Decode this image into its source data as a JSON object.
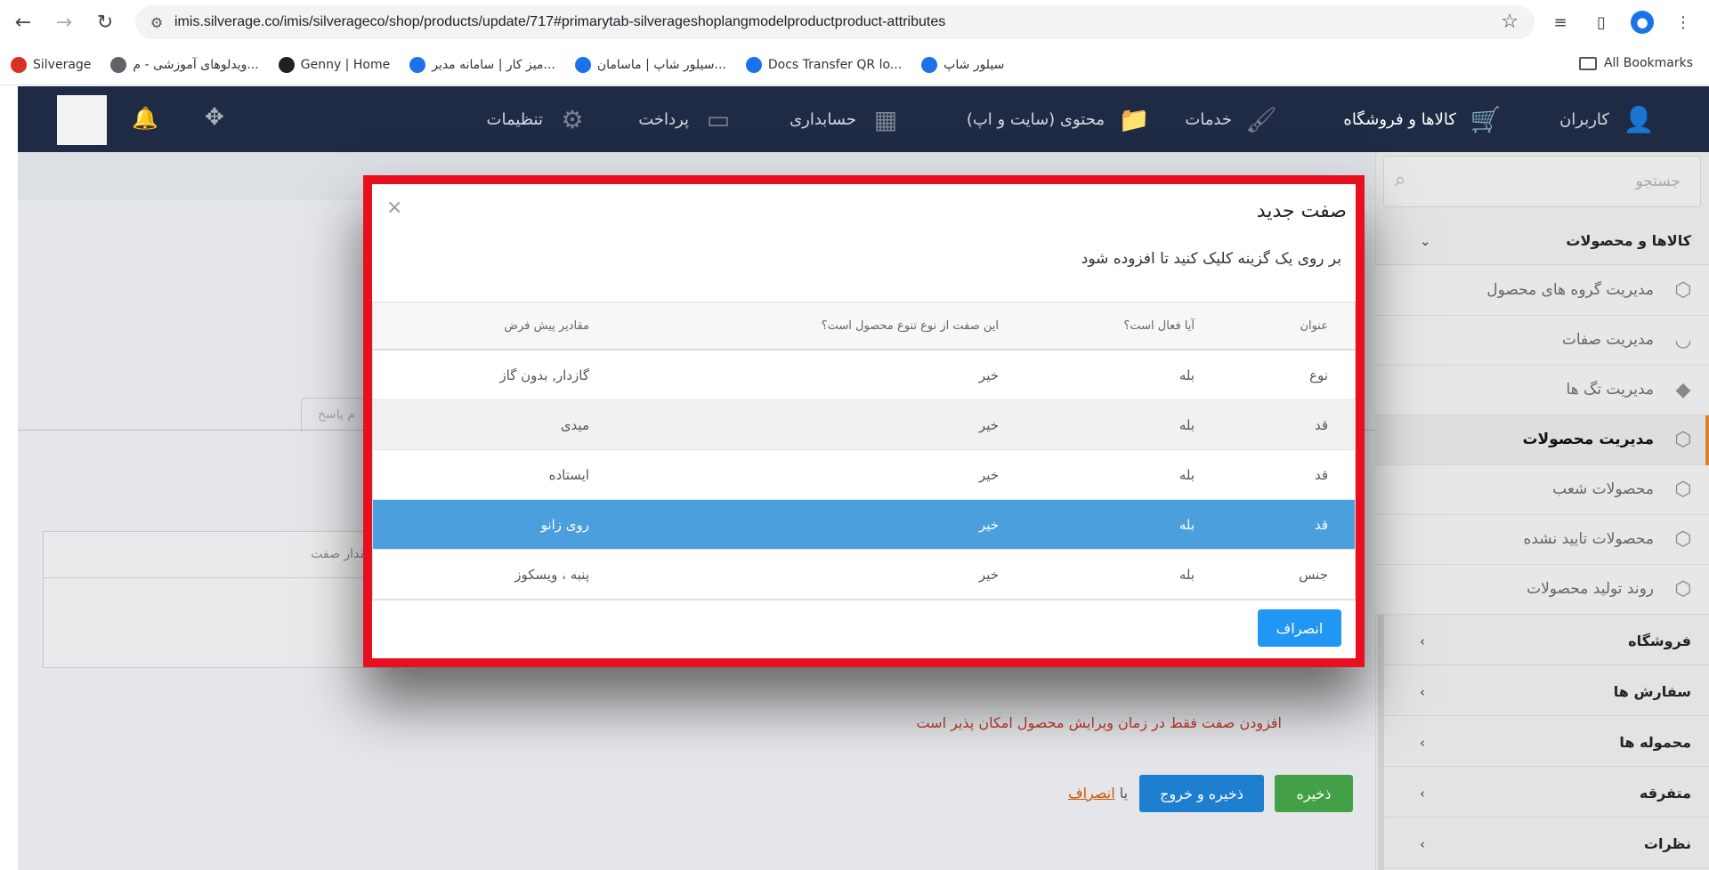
{
  "browser": {
    "url": "imis.silverage.co/imis/silverageco/shop/products/update/717#primarytab-silverageshoplangmodelproductproduct-attributes",
    "bookmarks": [
      {
        "label": "Silverage",
        "color": "#d93025"
      },
      {
        "label": "ویدلوهای آموزشی - م...",
        "color": "#5f6368"
      },
      {
        "label": "Genny | Home",
        "color": "#202124"
      },
      {
        "label": "میز کار | سامانه مدیر...",
        "color": "#1a73e8"
      },
      {
        "label": "سیلور شاپ | ماسامان...",
        "color": "#1a73e8"
      },
      {
        "label": "Docs Transfer QR lo...",
        "color": "#1a73e8"
      },
      {
        "label": "سیلور شاپ",
        "color": "#1a73e8"
      }
    ],
    "all_bookmarks": "All Bookmarks"
  },
  "topnav": {
    "items": [
      {
        "label": "کاربران",
        "icon": "user-icon"
      },
      {
        "label": "کالاها و فروشگاه",
        "icon": "cart-icon"
      },
      {
        "label": "خدمات",
        "icon": "brush-icon"
      },
      {
        "label": "محتوی (سایت و اپ)",
        "icon": "folder-icon"
      },
      {
        "label": "حسابداری",
        "icon": "calculator-icon"
      },
      {
        "label": "پرداخت",
        "icon": "card-icon"
      },
      {
        "label": "تنظیمات",
        "icon": "gears-icon"
      }
    ]
  },
  "sidebar": {
    "search_placeholder": "جستجو",
    "section_main": "کالاها و محصولات",
    "items": [
      {
        "label": "مدیریت گروه های محصول"
      },
      {
        "label": "مدیریت صفات"
      },
      {
        "label": "مدیریت تگ ها"
      },
      {
        "label": "مدیریت محصولات"
      },
      {
        "label": "محصولات شعب"
      },
      {
        "label": "محصولات تایید نشده"
      },
      {
        "label": "روند تولید محصولات"
      }
    ],
    "sections": [
      {
        "label": "فروشگاه"
      },
      {
        "label": "سفارش ها"
      },
      {
        "label": "محموله ها"
      },
      {
        "label": "متفرقه"
      },
      {
        "label": "نظرات"
      }
    ]
  },
  "page": {
    "tab_stub": "م پاسخ",
    "attr_value_header": "مقدار صفت",
    "warning": "افزودن صفت فقط در زمان ویرایش محصول امکان پذیر است",
    "save": "ذخیره",
    "save_exit": "ذخیره و خروج",
    "or": "یا",
    "cancel_link": "انصراف"
  },
  "modal": {
    "title": "صفت جدید",
    "subtitle": "بر روی یک گزینه کلیک کنید تا افزوده شود",
    "headers": {
      "title": "عنوان",
      "active": "آیا فعال است؟",
      "variant": "این صفت از نوع تنوع محصول است؟",
      "defaults": "مقادیر پیش فرض"
    },
    "rows": [
      {
        "title": "نوع",
        "active": "بله",
        "variant": "خیر",
        "defaults": "گازدار, بدون گاز"
      },
      {
        "title": "قد",
        "active": "بله",
        "variant": "خیر",
        "defaults": "میدی"
      },
      {
        "title": "قد",
        "active": "بله",
        "variant": "خیر",
        "defaults": "ایستاده"
      },
      {
        "title": "قد",
        "active": "بله",
        "variant": "خیر",
        "defaults": "روی زانو"
      },
      {
        "title": "جنس",
        "active": "بله",
        "variant": "خیر",
        "defaults": "پنبه ، ویسکوز"
      }
    ],
    "cancel": "انصراف"
  }
}
